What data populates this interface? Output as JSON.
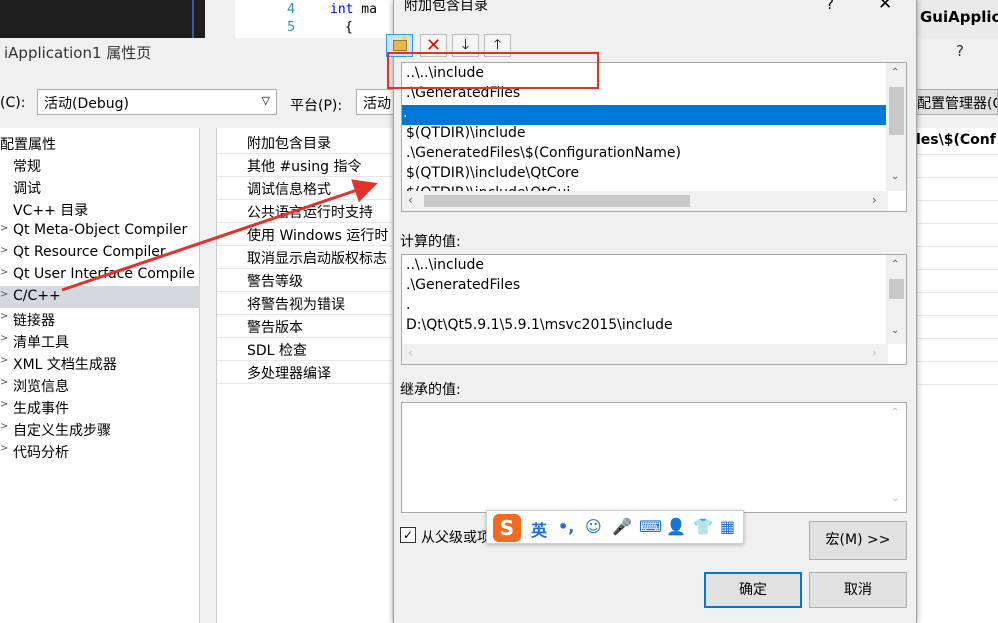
{
  "code": {
    "lines": [
      {
        "num": "4",
        "keyword": "int",
        "rest": " ma"
      },
      {
        "num": "5",
        "keyword": "",
        "rest": "{"
      }
    ],
    "right_title": "GuiApplicat"
  },
  "property_page": {
    "title": "iApplication1 属性页",
    "help": "?",
    "config_label": "(C):",
    "config_value": "活动(Debug)",
    "platform_label": "平台(P):",
    "platform_value": "活动",
    "config_manager": "配置管理器(C",
    "tree_items": [
      {
        "label": "配置属性",
        "twisty": ""
      },
      {
        "label": "常规",
        "twisty": ""
      },
      {
        "label": "调试",
        "twisty": ""
      },
      {
        "label": "VC++ 目录",
        "twisty": ""
      },
      {
        "label": "Qt Meta-Object Compiler",
        "twisty": ">"
      },
      {
        "label": "Qt Resource Compiler",
        "twisty": ">"
      },
      {
        "label": "Qt User Interface Compile",
        "twisty": ">"
      },
      {
        "label": "C/C++",
        "twisty": ">"
      },
      {
        "label": "链接器",
        "twisty": ">"
      },
      {
        "label": "清单工具",
        "twisty": ">"
      },
      {
        "label": "XML 文档生成器",
        "twisty": ">"
      },
      {
        "label": "浏览信息",
        "twisty": ">"
      },
      {
        "label": "生成事件",
        "twisty": ">"
      },
      {
        "label": "自定义生成步骤",
        "twisty": ">"
      },
      {
        "label": "代码分析",
        "twisty": ">"
      }
    ],
    "property_items": [
      "附加包含目录",
      "其他 #using 指令",
      "调试信息格式",
      "公共语言运行时支持",
      "使用 Windows 运行时",
      "取消显示启动版权标志",
      "警告等级",
      "将警告视为错误",
      "警告版本",
      "SDL 检查",
      "多处理器编译"
    ],
    "right_value": "les\\$(Conf"
  },
  "dialog": {
    "title": "附加包含目录",
    "help": "?",
    "close": "✕",
    "toolbar": {
      "down": "🡓",
      "up": "🡑",
      "delete": "✕"
    },
    "include_rows": [
      "..\\..\\include",
      ".\\GeneratedFiles",
      ".",
      "$(QTDIR)\\include",
      ".\\GeneratedFiles\\$(ConfigurationName)",
      "$(QTDIR)\\include\\QtCore",
      "$(QTDIR)\\include\\QtGui"
    ],
    "calc_label": "计算的值:",
    "calc_rows": [
      "..\\..\\include",
      ".\\GeneratedFiles",
      ".",
      "D:\\Qt\\Qt5.9.1\\5.9.1\\msvc2015\\include"
    ],
    "inherit_label": "继承的值:",
    "inherit_checkbox_label": "从父级或项目默认设置继承(I)",
    "macro_button": "宏(M) >>",
    "ok_button": "确定",
    "cancel_button": "取消"
  },
  "ime_toolbar": {
    "logo": "S",
    "items": [
      "英",
      "•,",
      "☺",
      "🎤",
      "⌨",
      "👤",
      "👕",
      "▦"
    ]
  },
  "colors": {
    "selection": "#0078d7",
    "annotation_red": "#e3322b",
    "ime_orange": "#f26b21"
  }
}
